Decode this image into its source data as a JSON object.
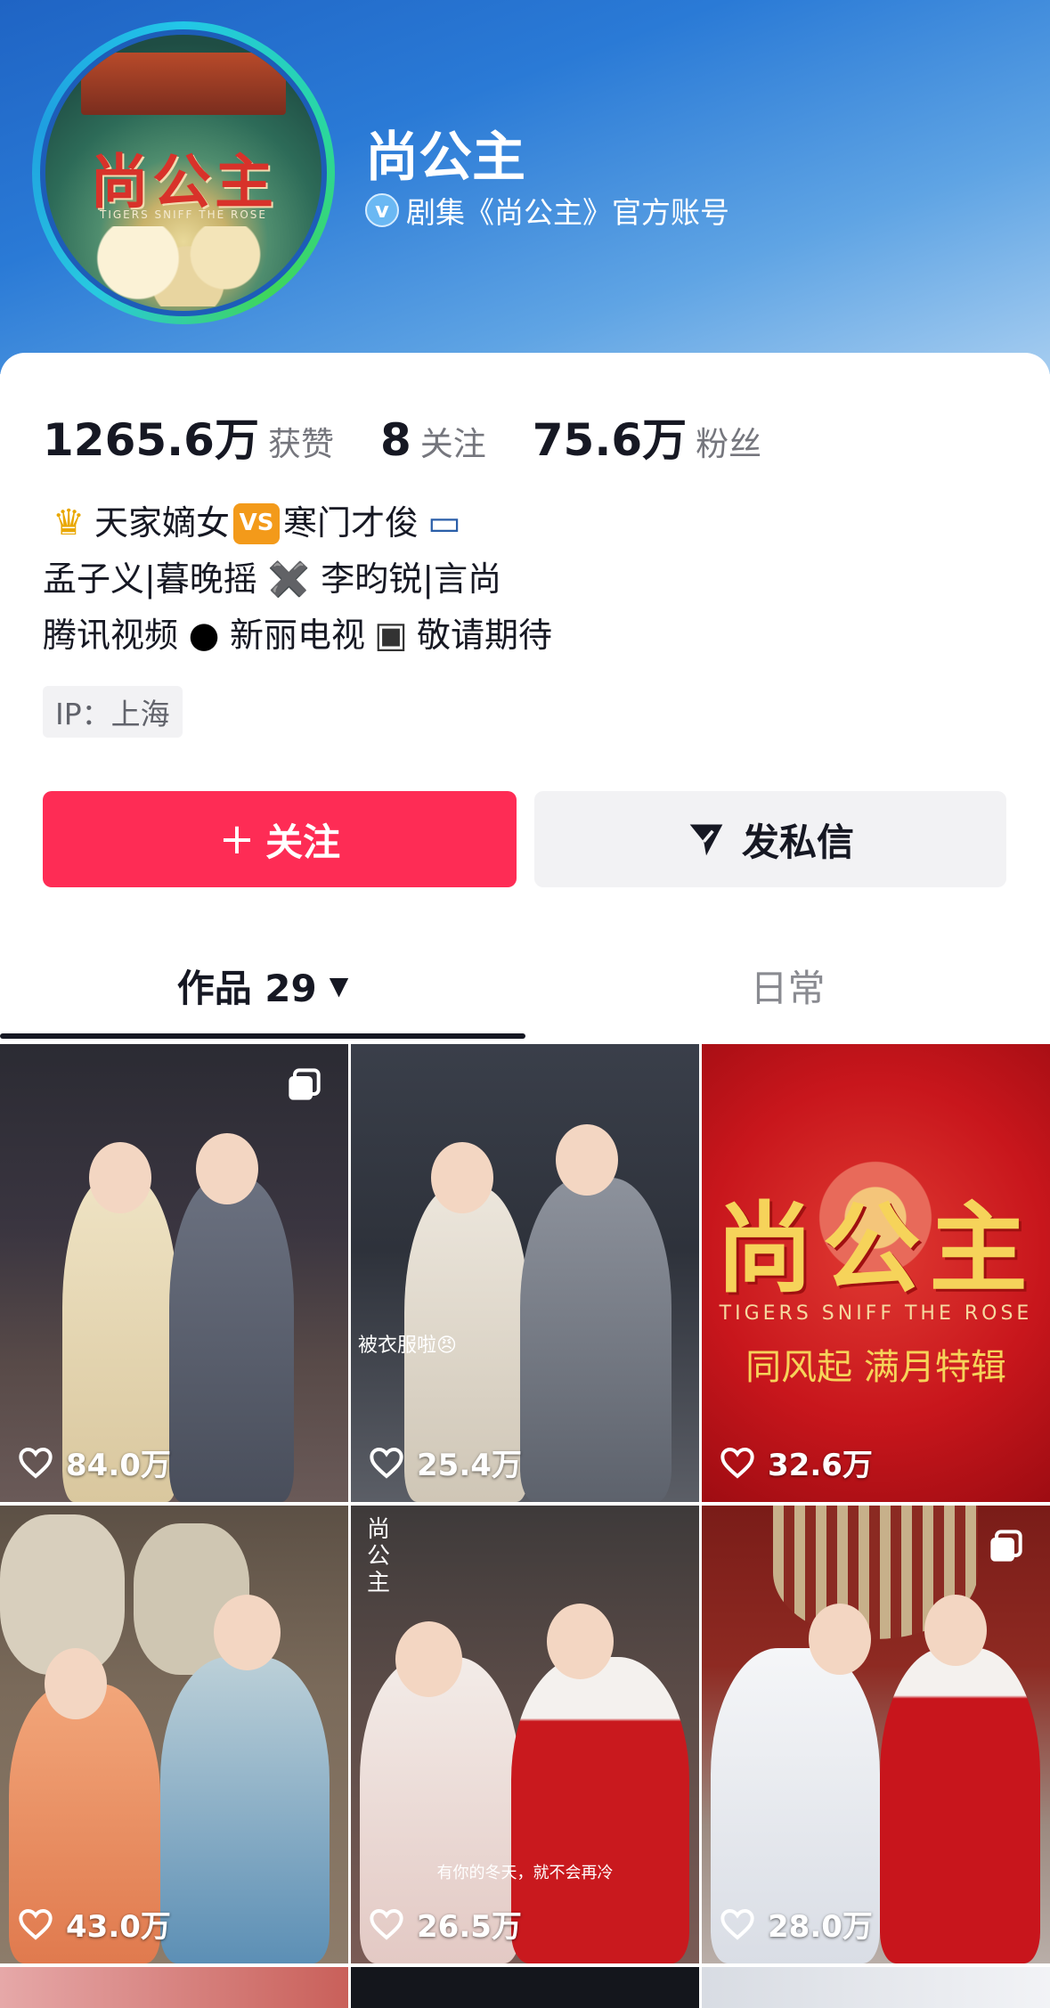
{
  "profile": {
    "name": "尚公主",
    "verified_text": "剧集《尚公主》官方账号",
    "avatar_logo": "尚公主",
    "avatar_subtitle": "TIGERS SNIFF THE ROSE"
  },
  "stats": {
    "likes_count": "1265.6万",
    "likes_label": "获赞",
    "following_count": "8",
    "following_label": "关注",
    "followers_count": "75.6万",
    "followers_label": "粉丝"
  },
  "bio": {
    "line1_a": "天家嫡女",
    "line1_vs": "VS",
    "line1_b": "寒门才俊",
    "line2": "孟子义|暮晚摇 ✖️ 李昀锐|言尚",
    "line3_a": "腾讯视频",
    "line3_b": "新丽电视",
    "line3_c": "敬请期待"
  },
  "ip_badge": "IP：上海",
  "actions": {
    "follow_label": "关注",
    "message_label": "发私信"
  },
  "tabs": {
    "works_label": "作品 29",
    "daily_label": "日常"
  },
  "videos": [
    {
      "likes": "84.0万",
      "multi": true
    },
    {
      "likes": "25.4万",
      "multi": false,
      "caption": "被衣服啦😠"
    },
    {
      "likes": "32.6万",
      "multi": false,
      "title": "尚公主",
      "subtitle": "TIGERS SNIFF THE ROSE",
      "subtitle2": "同风起 满月特辑"
    },
    {
      "likes": "43.0万",
      "multi": false
    },
    {
      "likes": "26.5万",
      "multi": false,
      "poster_title": "尚公主",
      "poster_caption": "有你的冬天，就不会再冷"
    },
    {
      "likes": "28.0万",
      "multi": true
    }
  ],
  "colors": {
    "follow_button": "#fe2c55",
    "banner": "#2a7ad6"
  }
}
